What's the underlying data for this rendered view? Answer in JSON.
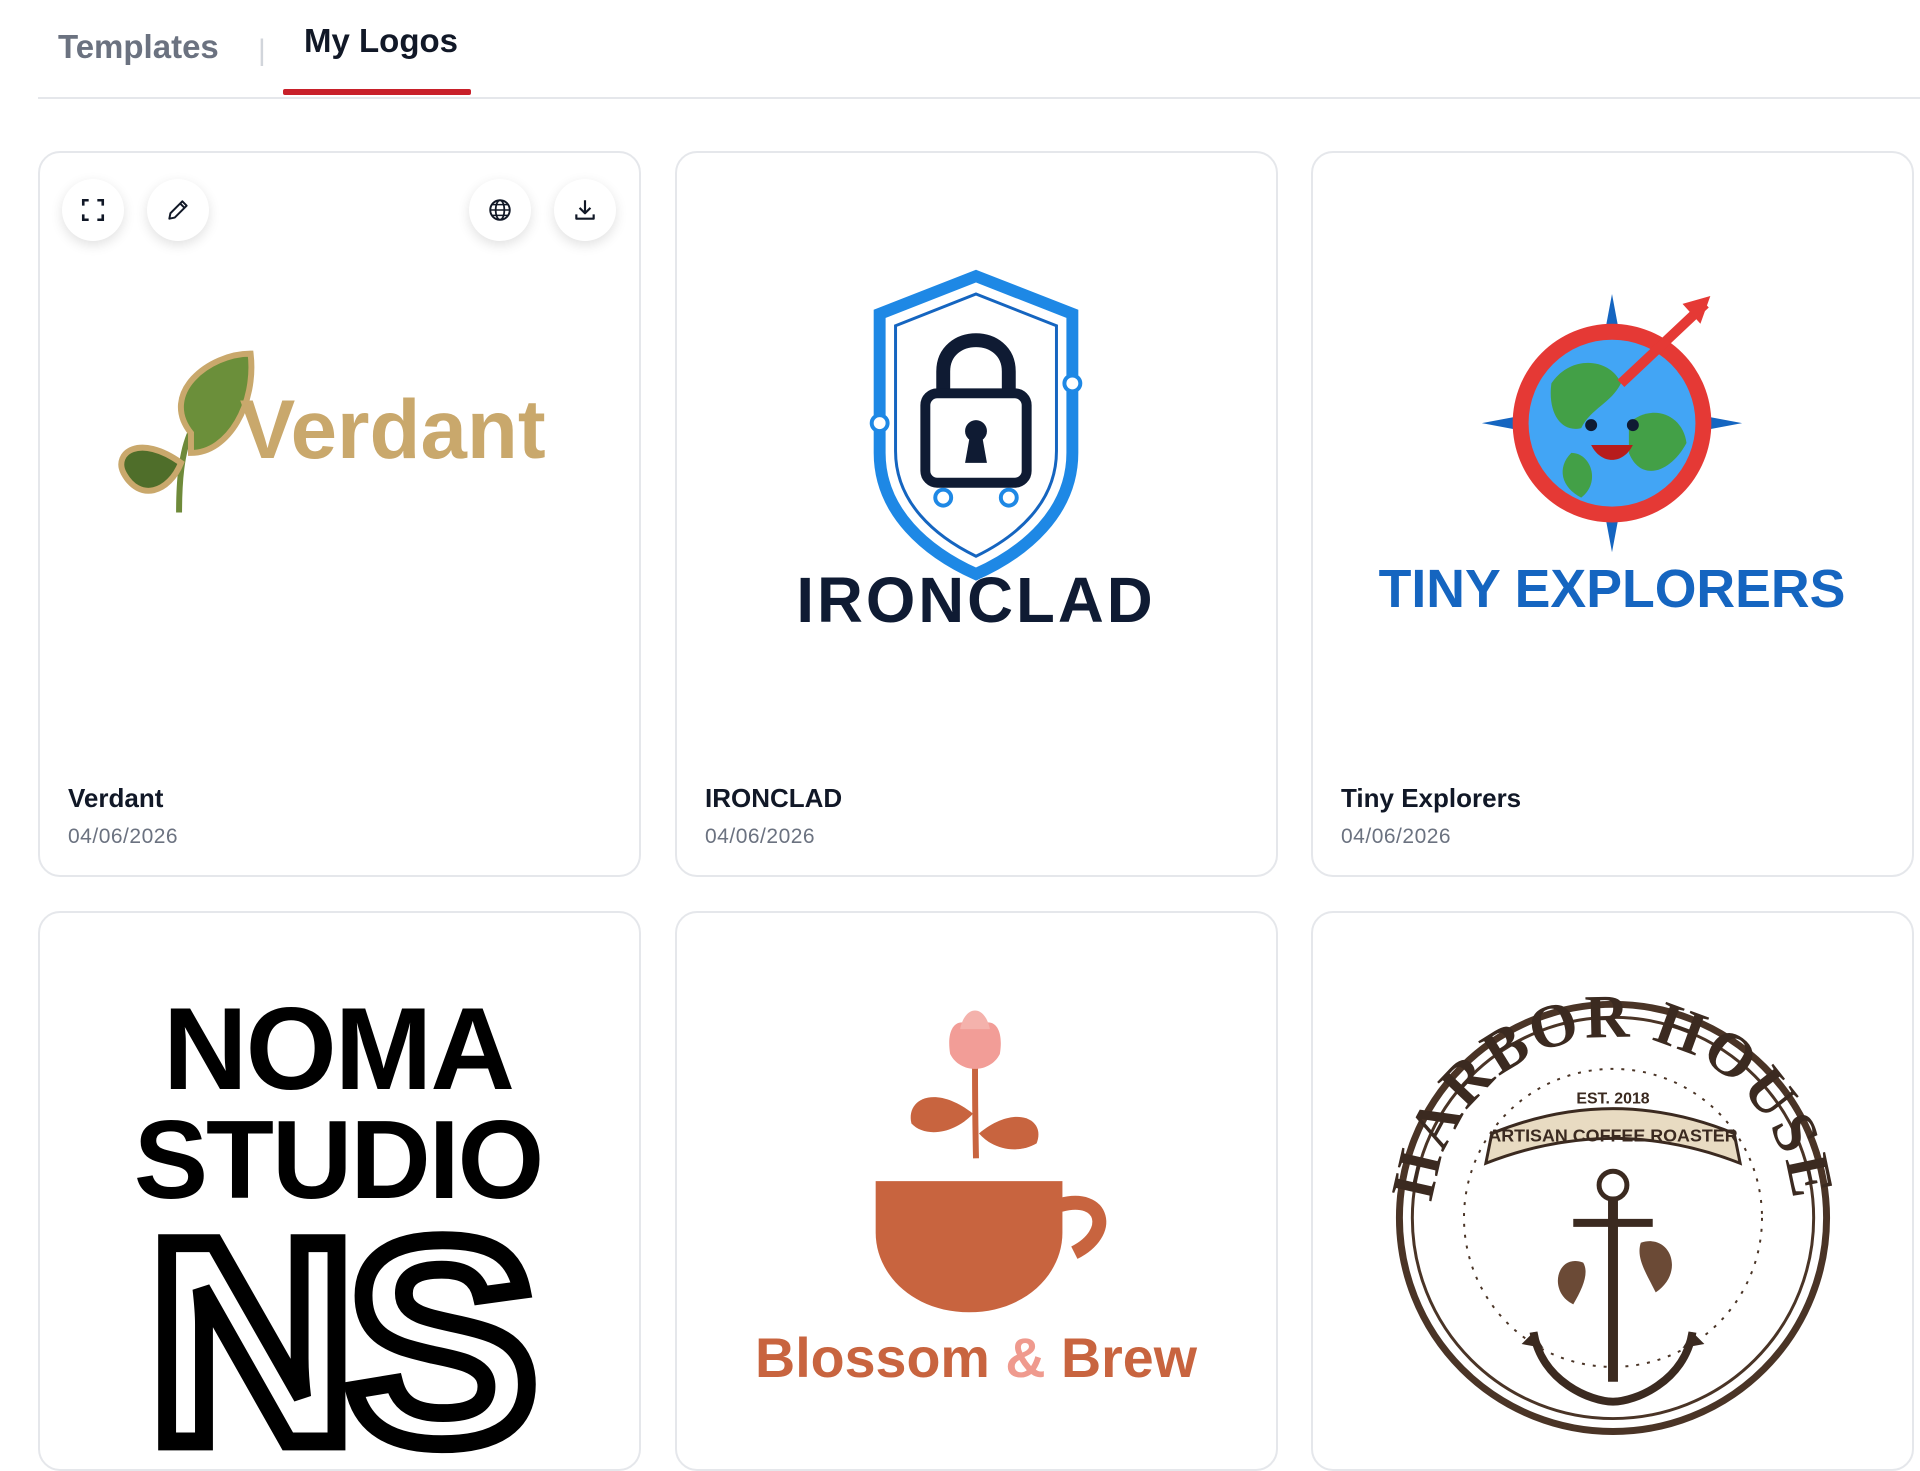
{
  "tabs": {
    "templates": "Templates",
    "separator": "|",
    "my_logos": "My Logos",
    "active": "My Logos"
  },
  "card_actions": {
    "expand": "expand-icon",
    "edit": "pencil-icon",
    "publish": "globe-icon",
    "download": "download-icon"
  },
  "logos": [
    {
      "title": "Verdant",
      "date": "04/06/2026",
      "wordmark": "Verdant",
      "color": "#c9a86c"
    },
    {
      "title": "IRONCLAD",
      "date": "04/06/2026",
      "wordmark": "IRONCLAD",
      "color": "#0f1b33"
    },
    {
      "title": "Tiny Explorers",
      "date": "04/06/2026",
      "wordmark": "TINY EXPLORERS",
      "color": "#1565c0"
    },
    {
      "title": "",
      "date": "",
      "wordmark_line1": "NOMA",
      "wordmark_line2": "STUDIO",
      "monogram": "NS"
    },
    {
      "title": "",
      "date": "",
      "wordmark_part1": "Blossom",
      "wordmark_amp": "&",
      "wordmark_part2": "Brew",
      "color": "#c8643f"
    },
    {
      "title": "",
      "date": "",
      "arc_text": "HARBOR HOUSE",
      "est": "EST. 2018",
      "ribbon": "ARTISAN COFFEE ROASTER"
    }
  ]
}
